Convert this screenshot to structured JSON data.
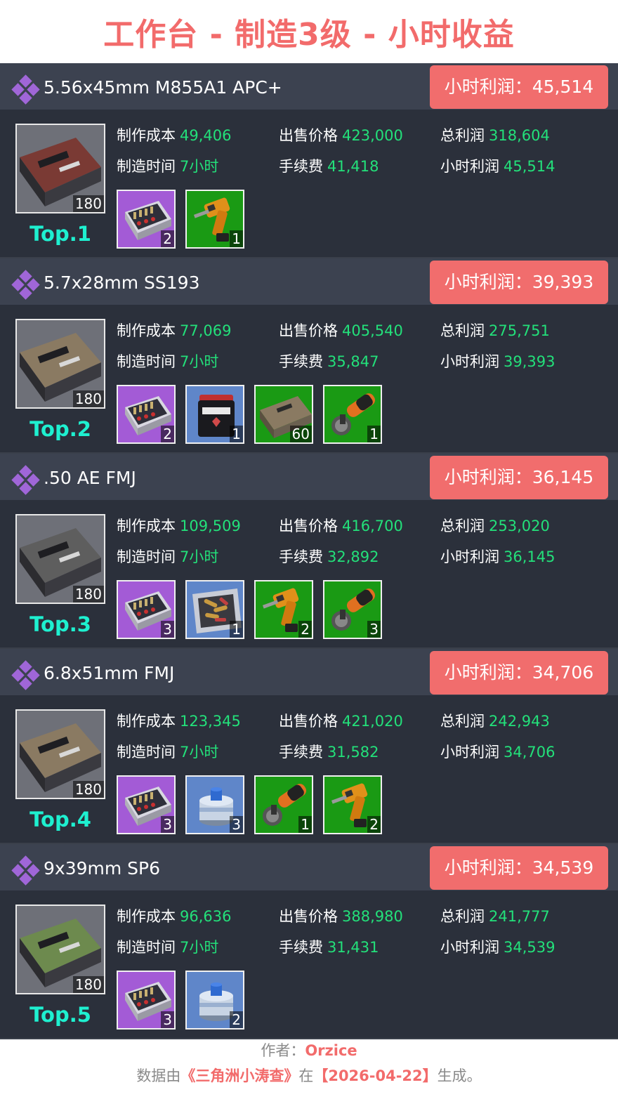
{
  "title": "工作台 - 制造3级 - 小时收益",
  "labels": {
    "cost": "制作成本",
    "sell": "出售价格",
    "total": "总利润",
    "time": "制造时间",
    "fee": "手续费",
    "hourly": "小时利润"
  },
  "items": [
    {
      "name": "5.56x45mm M855A1 APC+",
      "badge": "小时利润：45,514",
      "qty": "180",
      "rank": "Top.1",
      "cost": "49,406",
      "sell": "423,000",
      "total": "318,604",
      "time": "7小时",
      "fee": "41,418",
      "hourly": "45,514",
      "thumb_color": "#7a3a34",
      "materials": [
        {
          "icon": "ammo-crate-icon",
          "bg": "purple",
          "qty": "2"
        },
        {
          "icon": "drill-icon",
          "bg": "green",
          "qty": "1"
        }
      ]
    },
    {
      "name": "5.7x28mm SS193",
      "badge": "小时利润：39,393",
      "qty": "180",
      "rank": "Top.2",
      "cost": "77,069",
      "sell": "405,540",
      "total": "275,751",
      "time": "7小时",
      "fee": "35,847",
      "hourly": "39,393",
      "thumb_color": "#8a7a62",
      "materials": [
        {
          "icon": "ammo-crate-icon",
          "bg": "purple",
          "qty": "2"
        },
        {
          "icon": "powder-can-icon",
          "bg": "blue",
          "qty": "1"
        },
        {
          "icon": "ammo-box-icon",
          "bg": "green",
          "qty": "60"
        },
        {
          "icon": "angle-grinder-icon",
          "bg": "green",
          "qty": "1"
        }
      ]
    },
    {
      "name": ".50 AE FMJ",
      "badge": "小时利润：36,145",
      "qty": "180",
      "rank": "Top.3",
      "cost": "109,509",
      "sell": "416,700",
      "total": "253,020",
      "time": "7小时",
      "fee": "32,892",
      "hourly": "36,145",
      "thumb_color": "#5e5e5e",
      "materials": [
        {
          "icon": "ammo-crate-icon",
          "bg": "purple",
          "qty": "3"
        },
        {
          "icon": "cartridge-tray-icon",
          "bg": "blue",
          "qty": "1"
        },
        {
          "icon": "drill-icon",
          "bg": "green",
          "qty": "2"
        },
        {
          "icon": "angle-grinder-icon",
          "bg": "green",
          "qty": "3"
        }
      ]
    },
    {
      "name": "6.8x51mm FMJ",
      "badge": "小时利润：34,706",
      "qty": "180",
      "rank": "Top.4",
      "cost": "123,345",
      "sell": "421,020",
      "total": "242,943",
      "time": "7小时",
      "fee": "31,582",
      "hourly": "34,706",
      "thumb_color": "#8a7a62",
      "materials": [
        {
          "icon": "ammo-crate-icon",
          "bg": "purple",
          "qty": "3"
        },
        {
          "icon": "fuel-canister-icon",
          "bg": "blue",
          "qty": "3"
        },
        {
          "icon": "angle-grinder-icon",
          "bg": "green",
          "qty": "1"
        },
        {
          "icon": "drill-icon",
          "bg": "green",
          "qty": "2"
        }
      ]
    },
    {
      "name": "9x39mm SP6",
      "badge": "小时利润：34,539",
      "qty": "180",
      "rank": "Top.5",
      "cost": "96,636",
      "sell": "388,980",
      "total": "241,777",
      "time": "7小时",
      "fee": "31,431",
      "hourly": "34,539",
      "thumb_color": "#6d8a4e",
      "materials": [
        {
          "icon": "ammo-crate-icon",
          "bg": "purple",
          "qty": "3"
        },
        {
          "icon": "fuel-canister-icon",
          "bg": "blue",
          "qty": "2"
        }
      ]
    }
  ],
  "footer": {
    "author_label": "作者：",
    "author": "Orzice",
    "source_prefix": "数据由",
    "source_name": "《三角洲小涛查》",
    "source_mid": "在",
    "date": "【2026-04-22】",
    "source_suffix": "生成。"
  }
}
